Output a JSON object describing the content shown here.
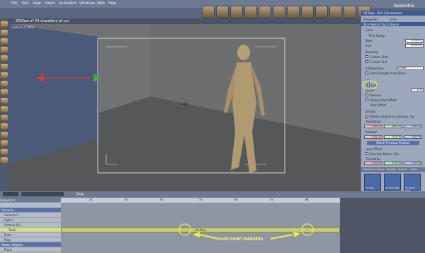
{
  "menu": [
    "File",
    "Edit",
    "View",
    "Insert",
    "Animation",
    "Windows",
    "Web",
    "Help"
  ],
  "app_mode": "Assemble",
  "viewport": {
    "title": "3DView of V4 shoulders at car",
    "camera_label": "Camera 1  100%"
  },
  "right_panel": {
    "header": "V4 Step - NLA Clip Instance",
    "tabs": [
      "Properties",
      "Links"
    ],
    "clip_title": "NLA Master Clip Instance",
    "color_label": "Color",
    "time_range": "Time Range",
    "start_label": "Start",
    "start_value": "00:00:00",
    "end_label": "End",
    "end_value": "00:00:00",
    "blending": "Blending",
    "custom_start": "Custom Start",
    "custom_end": "Custom End",
    "interpolation_label": "Interpolation",
    "interpolation_value": "Smooth",
    "extra_smooth": "Extra Smooth Auto Blend",
    "clip_label": "Clip",
    "loop_label": "Loop",
    "speed_label": "Speed",
    "speed_value": "1.00",
    "reverse_label": "Reverse",
    "unlock_start": "Unlock Start Offset",
    "start_offset": "Start Offset",
    "offsets": "Offsets",
    "offsets_relative": "Offsets relative to previous clip",
    "translation_label": "Translation",
    "rotation_label": "Rotation",
    "match_button": "Match Previous Position",
    "loop_offset": "Loop Offset",
    "override_master": "Override Master Clip",
    "translation2_label": "Translation",
    "xyz": [
      "0.00 m",
      "0.00 m",
      "0.00 m"
    ],
    "rot": [
      "0.00 m",
      "0.00 m",
      "0.00 m"
    ],
    "bottom_tabs": [
      "Instances",
      "Library",
      "Presets",
      "Scenes",
      "Clips"
    ],
    "clip_thumbs": [
      "V4 Step",
      "V4 Slow Walk",
      "V4 Chest Walk"
    ]
  },
  "timeline": {
    "sequencer_label": "Sequencer",
    "snap_label": "Snap",
    "tracks": [
      "Universe",
      "Camera 1",
      "Light 1",
      "Victoria 4.2",
      "Track",
      "Floor",
      "Prop",
      "Master Objects",
      "Plane"
    ],
    "ticks": [
      "2s",
      "3s",
      "4s",
      "5s",
      "6s",
      "7s",
      "8s"
    ],
    "clip_label": "V4 Step",
    "annotation": "LOOP POINT MARKERS"
  }
}
